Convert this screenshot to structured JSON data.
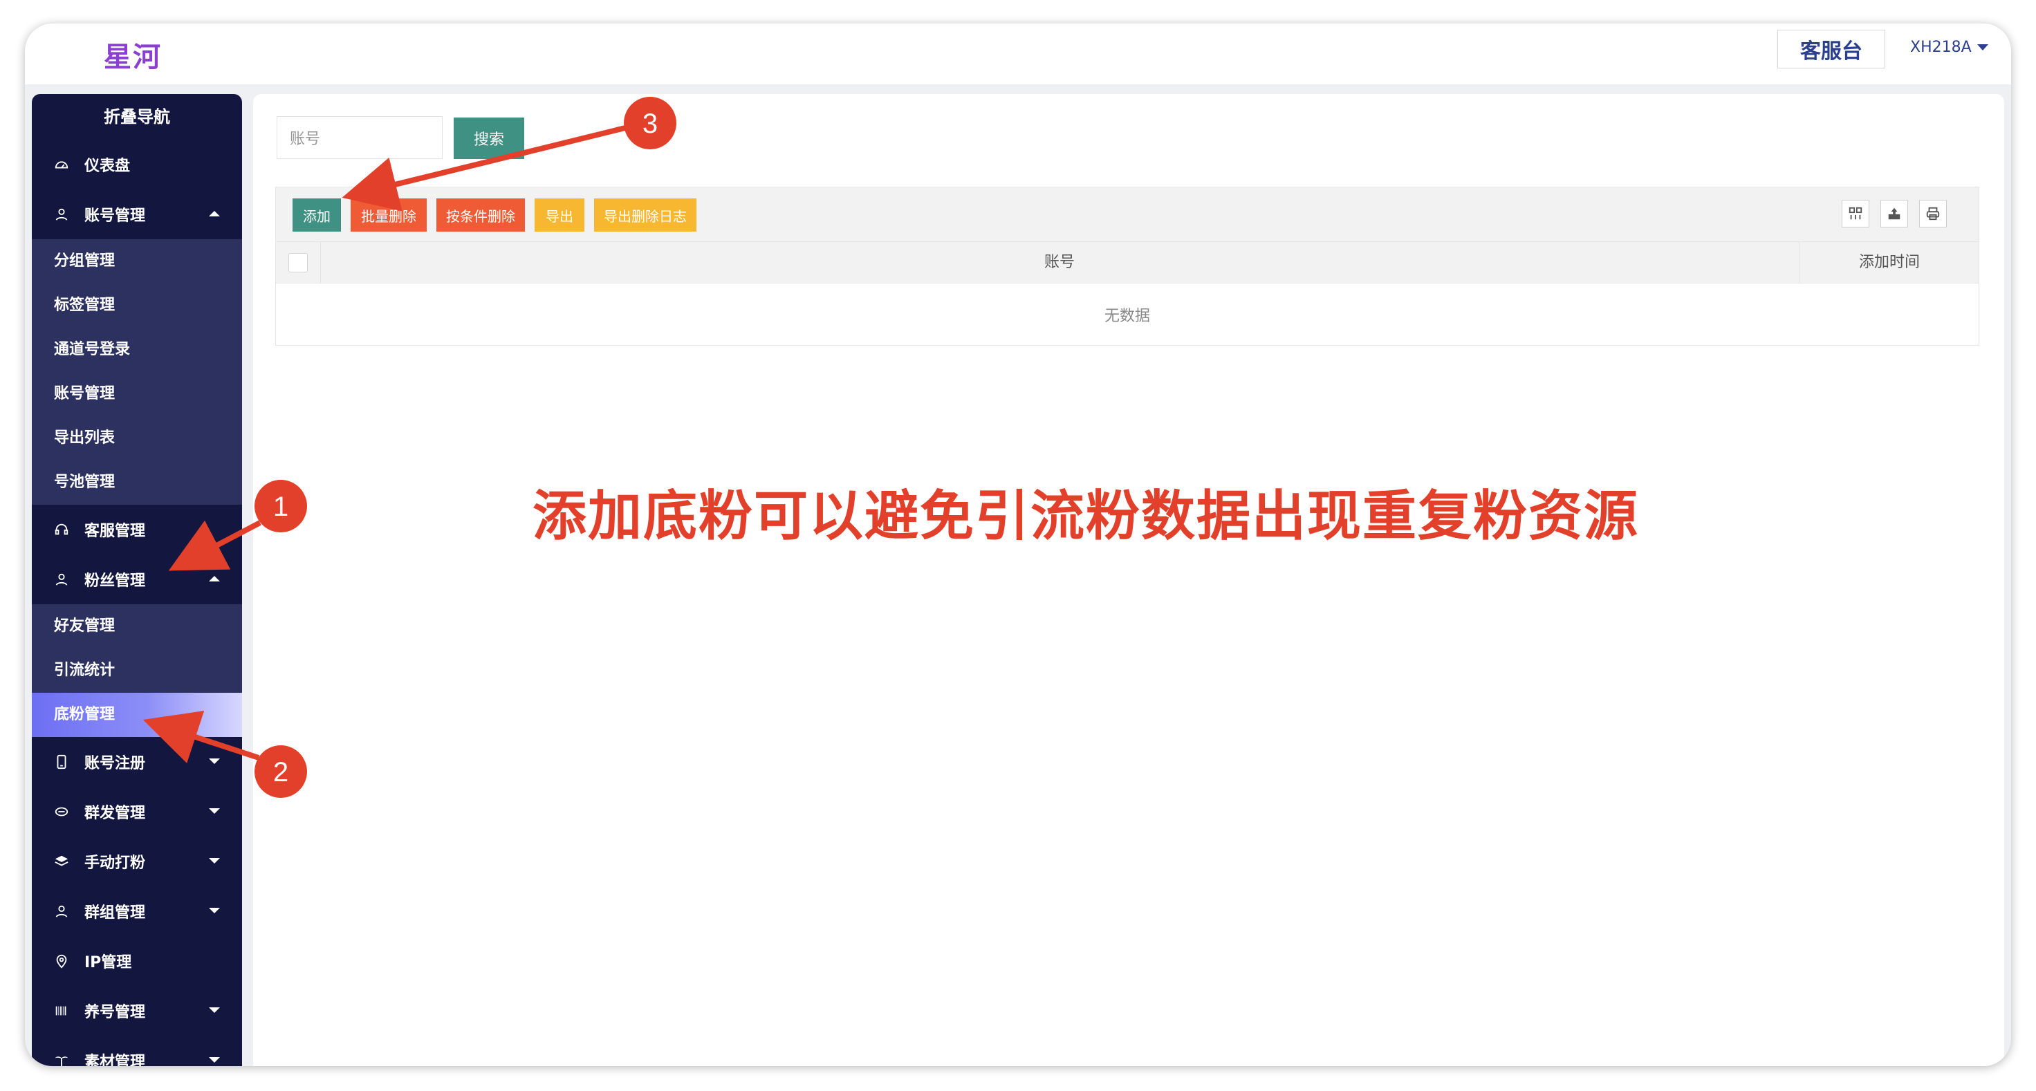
{
  "header": {
    "logo": "星河",
    "kefu_button": "客服台",
    "user": "XH218A"
  },
  "sidebar": {
    "title": "折叠导航",
    "items": [
      {
        "label": "仪表盘",
        "icon": "dashboard-icon"
      },
      {
        "label": "账号管理",
        "icon": "user-icon",
        "expanded": true,
        "children": [
          "分组管理",
          "标签管理",
          "通道号登录",
          "账号管理",
          "导出列表",
          "号池管理"
        ]
      },
      {
        "label": "客服管理",
        "icon": "headset-icon"
      },
      {
        "label": "粉丝管理",
        "icon": "fans-icon",
        "expanded": true,
        "children": [
          "好友管理",
          "引流统计",
          "底粉管理"
        ],
        "active_child": "底粉管理"
      },
      {
        "label": "账号注册",
        "icon": "phone-icon"
      },
      {
        "label": "群发管理",
        "icon": "broadcast-icon"
      },
      {
        "label": "手动打粉",
        "icon": "layers-icon"
      },
      {
        "label": "群组管理",
        "icon": "group-icon"
      },
      {
        "label": "IP管理",
        "icon": "location-icon"
      },
      {
        "label": "养号管理",
        "icon": "barcode-icon"
      },
      {
        "label": "素材管理",
        "icon": "palm-icon"
      }
    ]
  },
  "search": {
    "placeholder": "账号",
    "button": "搜索"
  },
  "toolbar": {
    "buttons": [
      {
        "label": "添加",
        "color": "#3f9183"
      },
      {
        "label": "批量删除",
        "color": "#ef5b34"
      },
      {
        "label": "按条件删除",
        "color": "#ef5b34"
      },
      {
        "label": "导出",
        "color": "#f7b731"
      },
      {
        "label": "导出删除日志",
        "color": "#f7b731"
      }
    ],
    "icons": [
      "columns-icon",
      "export-icon",
      "print-icon"
    ]
  },
  "table": {
    "columns": [
      "账号",
      "添加时间"
    ],
    "empty_text": "无数据"
  },
  "annotation": {
    "text": "添加底粉可以避免引流粉数据出现重复粉资源",
    "markers": [
      "1",
      "2",
      "3"
    ],
    "color": "#e2402a"
  }
}
